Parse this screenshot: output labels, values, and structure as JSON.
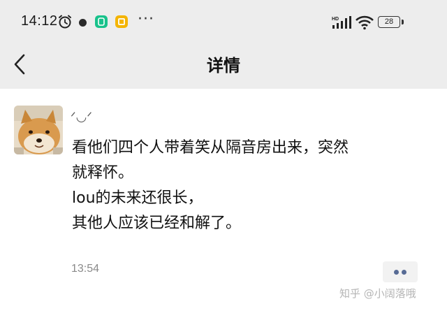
{
  "status_bar": {
    "time": "14:12",
    "more": "···",
    "battery": "28",
    "network": "HD"
  },
  "header": {
    "title": "详情"
  },
  "post": {
    "emoticon": "ᐟ◡ᐟ",
    "lines": [
      "看他们四个人带着笑从隔音房出来，突然",
      "就释怀。",
      "lou的未来还很长，",
      "其他人应该已经和解了。"
    ],
    "timestamp": "13:54"
  },
  "watermark": "知乎 @小阔落哦",
  "colors": {
    "header_bg": "#ededed",
    "link_blue": "#576b95",
    "app_green": "#18c28b",
    "app_yellow": "#f4b400"
  }
}
